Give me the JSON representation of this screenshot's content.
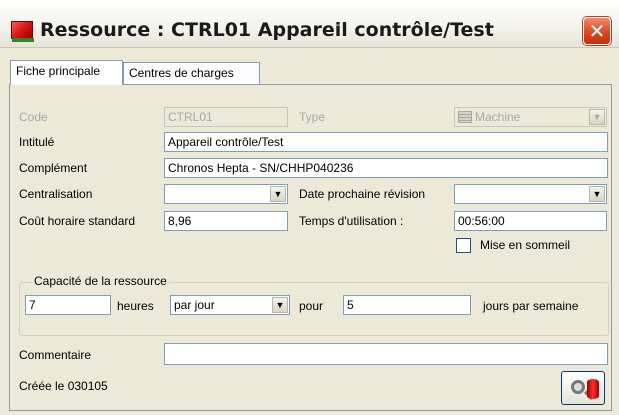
{
  "window": {
    "title": "Ressource : CTRL01 Appareil contrôle/Test",
    "close_icon": "close-icon"
  },
  "tabs": [
    {
      "label": "Fiche principale",
      "active": true
    },
    {
      "label": "Centres de charges",
      "active": false
    }
  ],
  "form": {
    "code_label": "Code",
    "code_value": "CTRL01",
    "type_label": "Type",
    "type_value": "Machine",
    "intitule_label": "Intitulé",
    "intitule_value": "Appareil contrôle/Test",
    "complement_label": "Complément",
    "complement_value": "Chronos Hepta - SN/CHHP040236",
    "centralisation_label": "Centralisation",
    "centralisation_value": "",
    "date_revision_label": "Date prochaine révision",
    "date_revision_value": "",
    "cout_label": "Coût horaire standard",
    "cout_value": "8,96",
    "temps_label": "Temps d'utilisation :",
    "temps_value": "00:56:00",
    "sommeil_label": "Mise en sommeil",
    "sommeil_checked": false
  },
  "capacite": {
    "title": "Capacité de la ressource",
    "heures_value": "7",
    "heures_label": "heures",
    "periode_value": "par jour",
    "pour_label": "pour",
    "jours_value": "5",
    "jours_label": "jours par semaine"
  },
  "commentaire": {
    "label": "Commentaire",
    "value": ""
  },
  "footer": {
    "creation_text": "Créée le 030105"
  }
}
